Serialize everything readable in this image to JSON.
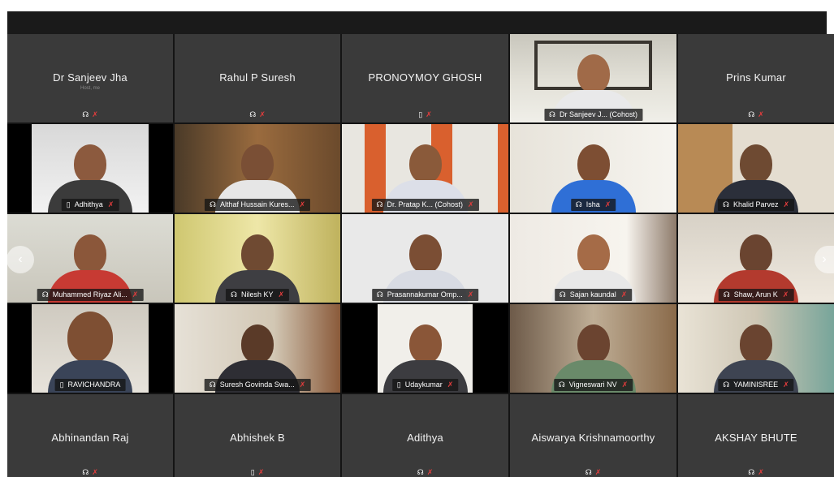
{
  "tiles": [
    {
      "name": "Dr Sanjeev Jha",
      "sub": "Host, me",
      "icon": "headphones-icon",
      "video": false
    },
    {
      "name": "Rahul P Suresh",
      "icon": "headphones-icon",
      "video": false
    },
    {
      "name": "PRONOYMOY GHOSH",
      "icon": "phone-icon",
      "video": false
    },
    {
      "name": "Dr Sanjeev J...  (Cohost)",
      "icon": "headphones-icon",
      "video": true
    },
    {
      "name": "Prins Kumar",
      "icon": "headphones-icon",
      "video": false
    },
    {
      "name": "Adhithya",
      "icon": "phone-icon",
      "video": true
    },
    {
      "name": "Althaf Hussain Kures...",
      "icon": "headphones-icon",
      "video": true
    },
    {
      "name": "Dr. Pratap K...  (Cohost)",
      "icon": "headphones-icon",
      "video": true
    },
    {
      "name": "Isha",
      "icon": "headphones-icon",
      "video": true
    },
    {
      "name": "Khalid Parvez",
      "icon": "headphones-icon",
      "video": true
    },
    {
      "name": "Muhammed Riyaz Ali...",
      "icon": "headphones-icon",
      "video": true
    },
    {
      "name": "Nilesh KY",
      "icon": "headphones-icon",
      "video": true
    },
    {
      "name": "Prasannakumar Omp...",
      "icon": "headphones-icon",
      "video": true
    },
    {
      "name": "Sajan kaundal",
      "icon": "headphones-icon",
      "video": true
    },
    {
      "name": "Shaw, Arun K",
      "icon": "headphones-icon",
      "video": true
    },
    {
      "name": "RAVICHANDRA",
      "icon": "phone-icon",
      "video": true
    },
    {
      "name": "Suresh Govinda Swa...",
      "icon": "headphones-icon",
      "video": true
    },
    {
      "name": "Udaykumar",
      "icon": "phone-icon",
      "video": true
    },
    {
      "name": "Vigneswari NV",
      "icon": "headphones-icon",
      "video": true
    },
    {
      "name": "YAMINISREE",
      "icon": "headphones-icon",
      "video": true
    },
    {
      "name": "Abhinandan Raj",
      "icon": "headphones-icon",
      "video": false
    },
    {
      "name": "Abhishek B",
      "icon": "phone-icon",
      "video": false
    },
    {
      "name": "Adithya",
      "icon": "headphones-icon",
      "video": false
    },
    {
      "name": "Aiswarya Krishnamoorthy",
      "icon": "headphones-icon",
      "video": false
    },
    {
      "name": "AKSHAY BHUTE",
      "icon": "headphones-icon",
      "video": false
    }
  ],
  "glyphs": {
    "headphones": "☊",
    "phone": "▯",
    "mic_muted": "✗",
    "prev": "‹",
    "next": "›"
  },
  "colors": {
    "mic_muted": "#e23c3c",
    "active_speaker": "#2ea7d9",
    "tile_bg": "#3a3a3a"
  }
}
